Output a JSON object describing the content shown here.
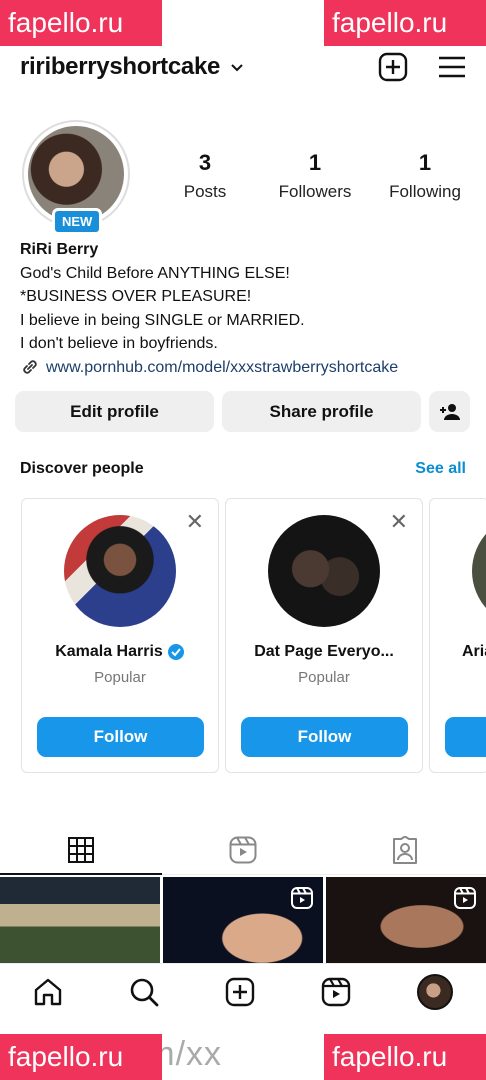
{
  "watermark": {
    "text": "fapello.ru",
    "url_text": "us.com/xx"
  },
  "header": {
    "username": "ririberryshortcake"
  },
  "profile": {
    "new_badge": "NEW",
    "stats": [
      {
        "num": "3",
        "label": "Posts"
      },
      {
        "num": "1",
        "label": "Followers"
      },
      {
        "num": "1",
        "label": "Following"
      }
    ],
    "name": "RiRi Berry",
    "bio_lines": [
      "God's Child Before ANYTHING ELSE!",
      "*BUSINESS OVER PLEASURE!",
      "I believe in being SINGLE or MARRIED.",
      "I don't believe in boyfriends."
    ],
    "link": "www.pornhub.com/model/xxxstrawberryshortcake"
  },
  "actions": {
    "edit": "Edit profile",
    "share": "Share profile"
  },
  "discover": {
    "title": "Discover people",
    "see_all": "See all",
    "cards": [
      {
        "name": "Kamala Harris",
        "sub": "Popular",
        "follow": "Follow",
        "verified": true
      },
      {
        "name": "Dat Page Everyo...",
        "sub": "Popular",
        "follow": "Follow",
        "verified": false
      },
      {
        "name": "Aria",
        "sub": "",
        "follow": "",
        "verified": false
      }
    ]
  },
  "colors": {
    "accent": "#1796ea",
    "watermark": "#f0335a",
    "link": "#1c3e6b",
    "verified": "#1796ea"
  }
}
